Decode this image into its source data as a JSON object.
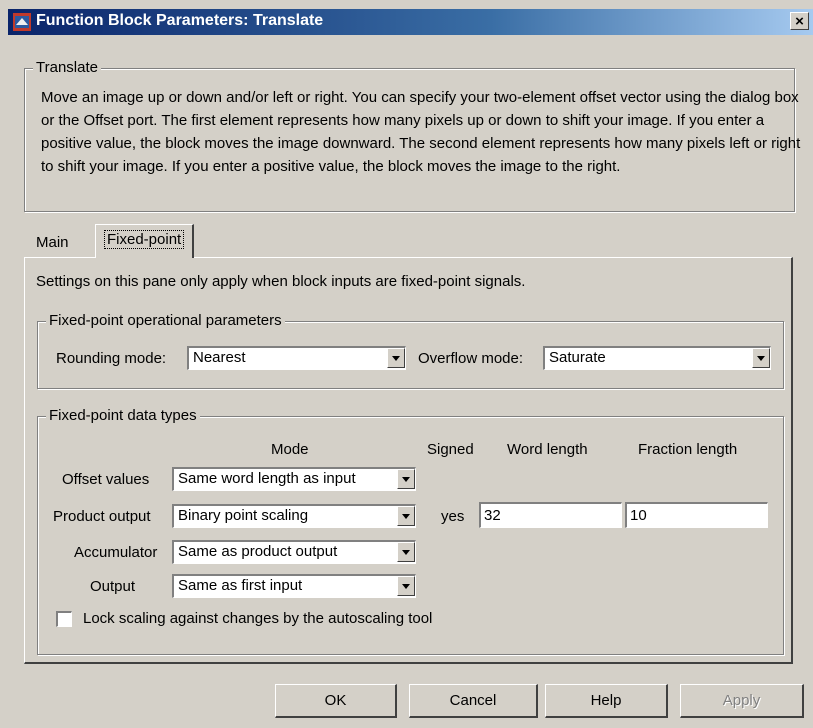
{
  "window": {
    "title": "Function Block Parameters: Translate",
    "icon": "simulink-block-icon",
    "close_label": "×"
  },
  "translate_group": {
    "legend": "Translate",
    "description": "Move an image up or down and/or left or right. You can specify your two-element offset vector using the dialog box or the Offset port. The first element represents how many pixels up or down to shift your image. If you enter a positive value, the block moves the image downward.  The second element represents how many pixels left or right to shift your image. If you enter a positive value, the block moves the image to the right."
  },
  "tabs": [
    {
      "label": "Main",
      "active": false
    },
    {
      "label": "Fixed-point",
      "active": true
    }
  ],
  "fixed_point": {
    "note": "Settings on this pane only apply when block inputs are fixed-point signals.",
    "operational": {
      "legend": "Fixed-point operational parameters",
      "rounding_label": "Rounding mode:",
      "rounding_value": "Nearest",
      "overflow_label": "Overflow mode:",
      "overflow_value": "Saturate"
    },
    "data_types": {
      "legend": "Fixed-point data types",
      "headers": {
        "mode": "Mode",
        "signed": "Signed",
        "word_length": "Word length",
        "fraction_length": "Fraction length"
      },
      "rows": [
        {
          "label": "Offset values",
          "mode": "Same word length as input"
        },
        {
          "label": "Product output",
          "mode": "Binary point scaling",
          "signed": "yes",
          "word_length": "32",
          "fraction_length": "10"
        },
        {
          "label": "Accumulator",
          "mode": "Same as product output"
        },
        {
          "label": "Output",
          "mode": "Same as first input"
        }
      ],
      "lock_label": "Lock scaling against changes by the autoscaling tool",
      "lock_checked": false
    }
  },
  "buttons": {
    "ok": "OK",
    "cancel": "Cancel",
    "help": "Help",
    "apply": "Apply"
  }
}
